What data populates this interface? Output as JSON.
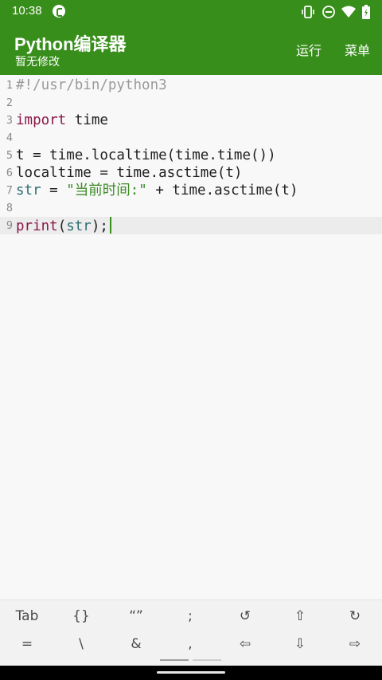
{
  "status_bar": {
    "time": "10:38",
    "icons": [
      "app-notification-icon",
      "vibrate-icon",
      "do-not-disturb-icon",
      "wifi-icon",
      "battery-icon"
    ]
  },
  "appbar": {
    "title": "Python编译器",
    "subtitle": "暂无修改",
    "actions": {
      "run": "运行",
      "menu": "菜单"
    },
    "color": "#388e1b"
  },
  "editor": {
    "line_numbers": [
      "1",
      "2",
      "3",
      "4",
      "5",
      "6",
      "7",
      "8",
      "9"
    ],
    "lines": [
      {
        "comment": "#!/usr/bin/python3"
      },
      {},
      {
        "keyword": "import",
        "rest": " time"
      },
      {},
      {
        "rest": "t = time.localtime(time.time())"
      },
      {
        "rest": "localtime = time.asctime(t)"
      },
      {
        "builtin": "str",
        "rest_a": " = ",
        "string": "\"当前时间:\"",
        "rest_b": " + time.asctime(t)"
      },
      {},
      {
        "keyword": "print",
        "punct_open": "(",
        "builtin": "str",
        "punct_close": ");"
      }
    ],
    "active_line": 9,
    "colors": {
      "keyword": "#8a1646",
      "builtin": "#2e6d74",
      "string": "#3c8a26",
      "comment": "#9a9a9a"
    }
  },
  "symbol_keys": {
    "row1": [
      "Tab",
      "{}",
      "“”",
      ";",
      "↺",
      "⇧",
      "↻"
    ],
    "row2": [
      "=",
      "\\",
      "&",
      ",",
      "⇦",
      "⇩",
      "⇨"
    ],
    "row1_names": [
      "tab-key",
      "braces-key",
      "quotes-key",
      "semicolon-key",
      "undo-key",
      "shift-up-key",
      "redo-key"
    ],
    "row2_names": [
      "equals-key",
      "backslash-key",
      "ampersand-key",
      "comma-key",
      "cursor-left-key",
      "cursor-down-key",
      "cursor-right-key"
    ],
    "page": 1,
    "pages": 2
  }
}
